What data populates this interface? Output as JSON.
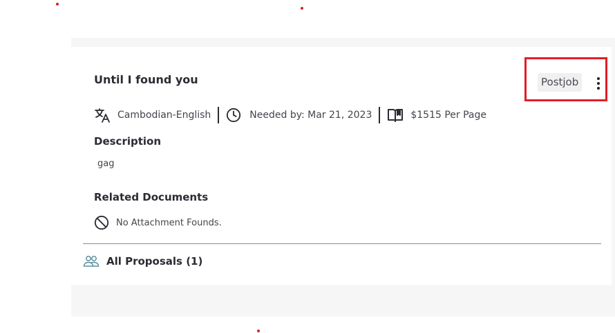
{
  "job": {
    "title": "Until I found you",
    "postjob_label": "Postjob",
    "language": "Cambodian-English",
    "needed_by": "Needed by: Mar 21, 2023",
    "rate": "$1515 Per Page"
  },
  "description": {
    "heading": "Description",
    "text": "gag"
  },
  "documents": {
    "heading": "Related Documents",
    "empty_text": "No Attachment Founds."
  },
  "proposals": {
    "label": "All Proposals (1)"
  },
  "colors": {
    "highlight_box": "#e01e26",
    "divider": "#6a9aa8",
    "people_icon": "#5a8fa0"
  },
  "icons": [
    "translate-icon",
    "clock-icon",
    "open-book-icon",
    "no-entry-icon",
    "people-icon",
    "more-vertical-icon"
  ]
}
